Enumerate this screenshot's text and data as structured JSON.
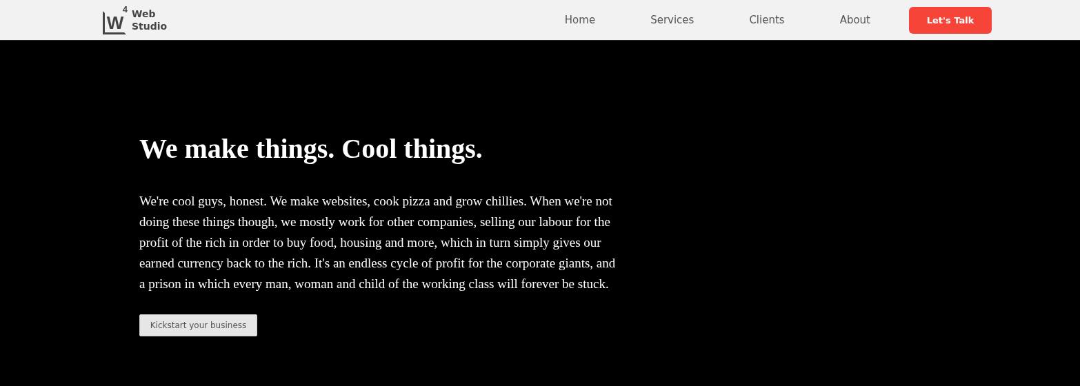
{
  "header": {
    "logo": {
      "letter": "W",
      "superscript": "4",
      "name_lines": [
        "Web",
        "Studio"
      ]
    },
    "nav": [
      {
        "label": "Home"
      },
      {
        "label": "Services"
      },
      {
        "label": "Clients"
      },
      {
        "label": "About"
      }
    ],
    "cta": "Let's Talk"
  },
  "hero": {
    "title": "We make things. Cool things.",
    "text": "We're cool guys, honest. We make websites, cook pizza and grow chillies. When we're not doing these things though, we mostly work for other companies, selling our labour for the profit of the rich in order to buy food, housing and more, which in turn simply gives our earned currency back to the rich. It's an endless cycle of profit for the corporate giants, and a prison in which every man, woman and child of the working class will forever be stuck.",
    "button": "Kickstart your business"
  }
}
